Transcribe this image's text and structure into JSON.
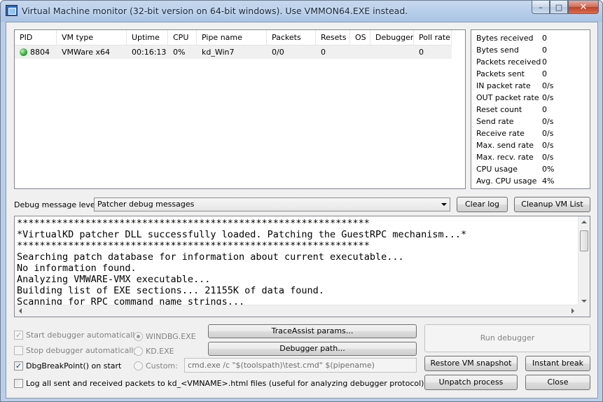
{
  "window": {
    "title": "Virtual Machine monitor (32-bit version on 64-bit windows). Use VMMON64.EXE instead.",
    "minimize_glyph": "–",
    "maximize_glyph": "□",
    "close_glyph": "✕"
  },
  "vm_table": {
    "columns": [
      "PID",
      "VM type",
      "Uptime",
      "CPU",
      "Pipe name",
      "Packets",
      "Resets",
      "OS",
      "Debugger",
      "Poll rate"
    ],
    "rows": [
      {
        "status_icon": "green-dot-icon",
        "pid": "8804",
        "vm_type": "VMWare x64",
        "uptime": "00:16:13",
        "cpu": "0%",
        "pipe_name": "kd_Win7",
        "packets": "0/0",
        "resets": "0",
        "os": "",
        "debugger": "",
        "poll_rate": "0"
      }
    ]
  },
  "stats": [
    {
      "label": "Bytes received",
      "value": "0"
    },
    {
      "label": "Bytes send",
      "value": "0"
    },
    {
      "label": "Packets received",
      "value": "0"
    },
    {
      "label": "Packets sent",
      "value": "0"
    },
    {
      "label": "IN packet rate",
      "value": "0/s"
    },
    {
      "label": "OUT packet rate",
      "value": "0/s"
    },
    {
      "label": "Reset count",
      "value": "0"
    },
    {
      "label": "Send rate",
      "value": "0/s"
    },
    {
      "label": "Receive rate",
      "value": "0/s"
    },
    {
      "label": "Max. send rate",
      "value": "0/s"
    },
    {
      "label": "Max. recv. rate",
      "value": "0/s"
    },
    {
      "label": "CPU usage",
      "value": "0%"
    },
    {
      "label": "Avg. CPU usage",
      "value": "4%"
    }
  ],
  "debug": {
    "level_label": "Debug message level:",
    "level_value": "Patcher debug messages",
    "clear_log_label": "Clear log",
    "cleanup_label": "Cleanup VM List"
  },
  "log_lines": [
    "**************************************************************",
    "*VirtualKD patcher DLL successfully loaded. Patching the GuestRPC mechanism...*",
    "**************************************************************",
    "Searching patch database for information about current executable...",
    "No information found.",
    "Analyzing VMWARE-VMX executable...",
    "Building list of EXE sections... 21155K of data found.",
    "Scanning for RPC command name strings..."
  ],
  "options": {
    "start_debugger": {
      "label": "Start debugger automatically",
      "checked": true
    },
    "stop_debugger": {
      "label": "Stop debugger automatically",
      "checked": false
    },
    "dbg_break": {
      "label": "DbgBreakPoint() on start",
      "checked": true
    },
    "log_packets": {
      "label": "Log all sent and received packets to kd_<VMNAME>.html files (useful for analyzing debugger protocol)",
      "checked": false
    },
    "radio_windbg": "WINDBG.EXE",
    "radio_kd": "KD.EXE",
    "radio_custom": "Custom:",
    "custom_command": "cmd.exe /c \"$(toolspath)\\test.cmd\" $(pipename)"
  },
  "buttons": {
    "traceassist": "TraceAssist params...",
    "debugger_path": "Debugger path...",
    "run_debugger": "Run debugger",
    "restore_snapshot": "Restore VM snapshot",
    "instant_break": "Instant break",
    "unpatch": "Unpatch process",
    "close": "Close"
  }
}
